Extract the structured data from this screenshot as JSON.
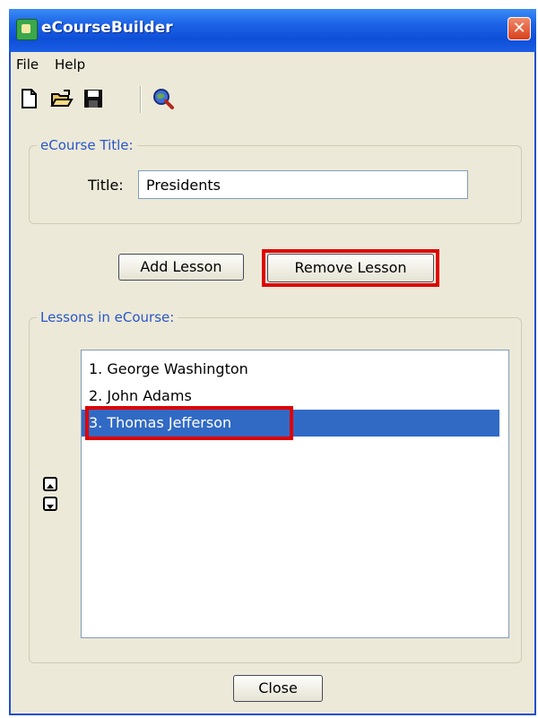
{
  "window": {
    "title": "eCourseBuilder",
    "close_glyph": "✕"
  },
  "menu": [
    "File",
    "Help"
  ],
  "toolbar": {
    "icons": [
      "new-document-icon",
      "open-folder-icon",
      "save-disk-icon",
      "search-globe-icon"
    ]
  },
  "title_group": {
    "legend": "eCourse Title:",
    "field_label": "Title:",
    "field_value": "Presidents"
  },
  "buttons": {
    "add_lesson": "Add Lesson",
    "remove_lesson": "Remove Lesson",
    "close": "Close"
  },
  "lessons_group": {
    "legend": "Lessons in eCourse:",
    "items": [
      {
        "label": "1. George Washington",
        "selected": false
      },
      {
        "label": "2. John Adams",
        "selected": false
      },
      {
        "label": "3. Thomas Jefferson",
        "selected": true
      }
    ]
  },
  "colors": {
    "titlebar": "#1c63e6",
    "selection": "#316ac5",
    "highlight": "#e00000",
    "legend_text": "#2a56c8"
  }
}
